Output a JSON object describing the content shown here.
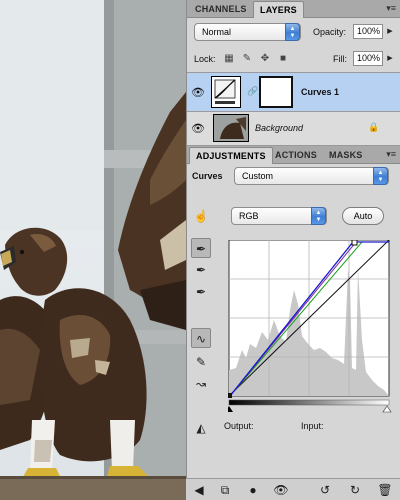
{
  "layers_panel": {
    "tabs": [
      "CHANNELS",
      "LAYERS"
    ],
    "active_tab": "LAYERS",
    "blend_mode": "Normal",
    "opacity_label": "Opacity:",
    "opacity_value": "100%",
    "lock_label": "Lock:",
    "fill_label": "Fill:",
    "fill_value": "100%",
    "layers": [
      {
        "name": "Curves 1",
        "selected": true,
        "visible": true,
        "type": "adjustment-curves"
      },
      {
        "name": "Background",
        "selected": false,
        "visible": true,
        "type": "image",
        "locked": true
      }
    ]
  },
  "adjustments_panel": {
    "tabs": [
      "ADJUSTMENTS",
      "ACTIONS",
      "MASKS"
    ],
    "active_tab": "ADJUSTMENTS",
    "preset_label": "Curves",
    "preset_value": "Custom",
    "channel_value": "RGB",
    "auto_label": "Auto",
    "output_label": "Output:",
    "input_label": "Input:"
  },
  "icons": {
    "panel_menu": "panel-menu-icon",
    "on_image_adjust": "hand-adjust-icon",
    "black_eyedropper": "eyedropper-black-icon",
    "gray_eyedropper": "eyedropper-gray-icon",
    "white_eyedropper": "eyedropper-white-icon",
    "curve_tool": "curve-tool-icon",
    "pencil_tool": "pencil-icon",
    "smooth_tool": "smooth-icon",
    "clipping": "clipping-warning-icon"
  },
  "colors": {
    "selected_layer": "#b7d1f3",
    "accent_blue": "#3d7fd6",
    "curve_blue": "#1a1ad0",
    "curve_purple": "#7a2ba0",
    "curve_green": "#16a016"
  }
}
